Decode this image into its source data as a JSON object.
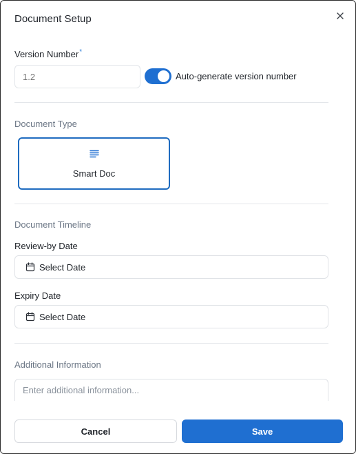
{
  "dialog": {
    "title": "Document Setup",
    "close_icon": "close-icon"
  },
  "version": {
    "label": "Version Number",
    "required_mark": "*",
    "placeholder": "1.2",
    "auto_generate_label": "Auto-generate version number",
    "auto_generate_on": true
  },
  "document_type": {
    "section_title": "Document Type",
    "options": [
      {
        "label": "Smart Doc",
        "icon": "text-lines-icon",
        "selected": true
      }
    ]
  },
  "timeline": {
    "section_title": "Document Timeline",
    "review_label": "Review-by Date",
    "review_value": "Select Date",
    "expiry_label": "Expiry Date",
    "expiry_value": "Select Date",
    "field_icon": "calendar-icon"
  },
  "additional": {
    "section_title": "Additional Information",
    "placeholder": "Enter additional information..."
  },
  "footer": {
    "cancel_label": "Cancel",
    "save_label": "Save"
  },
  "colors": {
    "accent": "#1f6fd1",
    "selected_border": "#1f6cc0",
    "required_mark": "#2f7fd6",
    "section_title": "#6b7685"
  }
}
